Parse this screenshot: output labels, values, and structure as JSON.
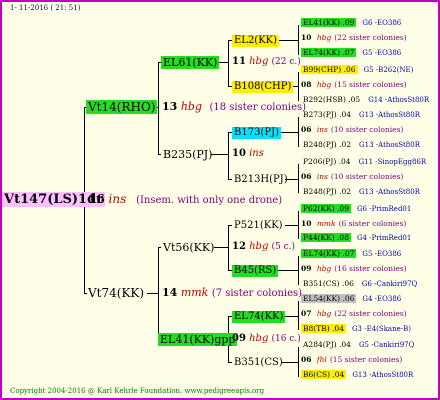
{
  "header": {
    "date": "1- 11-2016 ( 21: 51)"
  },
  "footer": {
    "copyright": "Copyright 2004-2016 @ Karl Kehrle Foundation.   www.pedigreeapis.org"
  },
  "root": {
    "label": "Vt147(LS)1dr",
    "num": "16",
    "yr": "ins",
    "note": "(Insem. with only one drone)"
  },
  "sire": {
    "label": "Vt14(RHO)",
    "num": "13",
    "yr": "hbg",
    "sis": "(18 sister colonies)"
  },
  "dam": {
    "label": "Vt74(KK)",
    "num": "14",
    "yr": "mmk",
    "sis": "(7 sister colonies)"
  },
  "g3": [
    {
      "label": "EL61(KK)",
      "num": "11",
      "yr": "hbg",
      "sis": "(22 c.)"
    },
    {
      "label": "B235(PJ)",
      "num": "10",
      "yr": "ins"
    },
    {
      "label": "Vt56(KK)",
      "num": "12",
      "yr": "hbg",
      "sis": "(5 c.)"
    },
    {
      "label": "EL41(KK)gpp",
      "num": "09",
      "yr": "hbg",
      "sis": "(16 c.)"
    }
  ],
  "g4": [
    {
      "label": "EL2(KK)"
    },
    {
      "label": "B108(CHP)"
    },
    {
      "label": "B173(PJ)"
    },
    {
      "label": "B213H(PJ)"
    },
    {
      "label": "P521(KK)"
    },
    {
      "label": "B45(RS)"
    },
    {
      "label": "EL74(KK)"
    },
    {
      "label": "B351(CS)"
    }
  ],
  "right": [
    {
      "label": "EL41(KK) .09",
      "ref": "G6 -EO386"
    },
    {
      "num": "10",
      "yr": "hbg",
      "sis": "(22 sister colonies)"
    },
    {
      "label": "EL74(KK) .07",
      "ref": "G5 -EO386"
    },
    {
      "label": "B99(CHP) .06",
      "ref": "G5 -B262(NE)"
    },
    {
      "num": "08",
      "yr": "hbg",
      "sis": "(15 sister colonies)"
    },
    {
      "label": "B292(HSB) .05",
      "ref": "G14 -AthosSt80R"
    },
    {
      "label": "B273(PJ) .04",
      "ref": "G13 -AthosSt80R"
    },
    {
      "num": "06",
      "yr": "ins",
      "sis": "(10 sister colonies)"
    },
    {
      "label": "B248(PJ) .02",
      "ref": "G13 -AthosSt80R"
    },
    {
      "label": "P206(PJ) .04",
      "ref": "G11 -SinopEgg86R"
    },
    {
      "num": "06",
      "yr": "ins",
      "sis": "(10 sister colonies)"
    },
    {
      "label": "B248(PJ) .02",
      "ref": "G13 -AthosSt80R"
    },
    {
      "label": "P62(KK) .09",
      "ref": "G6 -PrimRed01"
    },
    {
      "num": "10",
      "yr": "mmk",
      "sis": "(6 sister colonies)"
    },
    {
      "label": "P44(KK) .08",
      "ref": "G4 -PrimRed01"
    },
    {
      "label": "EL74(KK) .07",
      "ref": "G5 -EO386"
    },
    {
      "num": "09",
      "yr": "hbg",
      "sis": "(16 sister colonies)"
    },
    {
      "label": "B351(CS) .06",
      "ref": "G6 -Cankiri97Q"
    },
    {
      "label": "EL54(KK) .06",
      "ref": "G4 -EO386"
    },
    {
      "num": "07",
      "yr": "hbg",
      "sis": "(22 sister colonies)"
    },
    {
      "label": "B8(TB) .04",
      "ref": "G3 -E4(Skane-B)"
    },
    {
      "label": "A284(PJ) .04",
      "ref": "G5 -Cankiri97Q"
    },
    {
      "num": "06",
      "yr": "fhl",
      "sis": "(15 sister colonies)"
    },
    {
      "label": "B6(CS) .04",
      "ref": "G13 -AthosSt80R"
    }
  ]
}
